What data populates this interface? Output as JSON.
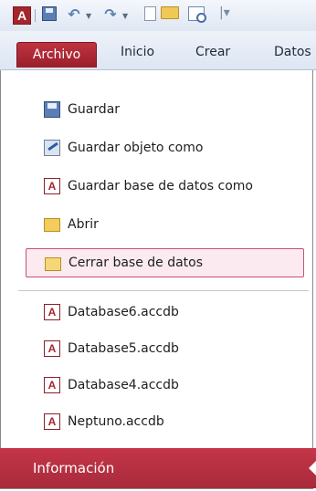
{
  "app": {
    "logo_letter": "A"
  },
  "ribbon": {
    "tabs": [
      {
        "label": "Archivo",
        "active": true
      },
      {
        "label": "Inicio"
      },
      {
        "label": "Crear"
      },
      {
        "label": "Datos"
      }
    ]
  },
  "backstage": {
    "commands": [
      {
        "label": "Guardar",
        "icon": "save-icon"
      },
      {
        "label": "Guardar objeto como",
        "icon": "save-object-as-icon"
      },
      {
        "label": "Guardar base de datos como",
        "icon": "save-database-as-icon"
      },
      {
        "label": "Abrir",
        "icon": "open-folder-icon"
      },
      {
        "label": "Cerrar base de datos",
        "icon": "close-database-icon",
        "selected": true
      }
    ],
    "recent": [
      {
        "label": "Database6.accdb",
        "icon": "access-db-icon"
      },
      {
        "label": "Database5.accdb",
        "icon": "access-db-icon"
      },
      {
        "label": "Database4.accdb",
        "icon": "access-db-icon"
      },
      {
        "label": "Neptuno.accdb",
        "icon": "access-db-icon"
      }
    ],
    "info_label": "Información"
  },
  "colors": {
    "accent": "#a4262c",
    "selected_bg": "#fbeaf0",
    "selected_border": "#c84d7b"
  }
}
